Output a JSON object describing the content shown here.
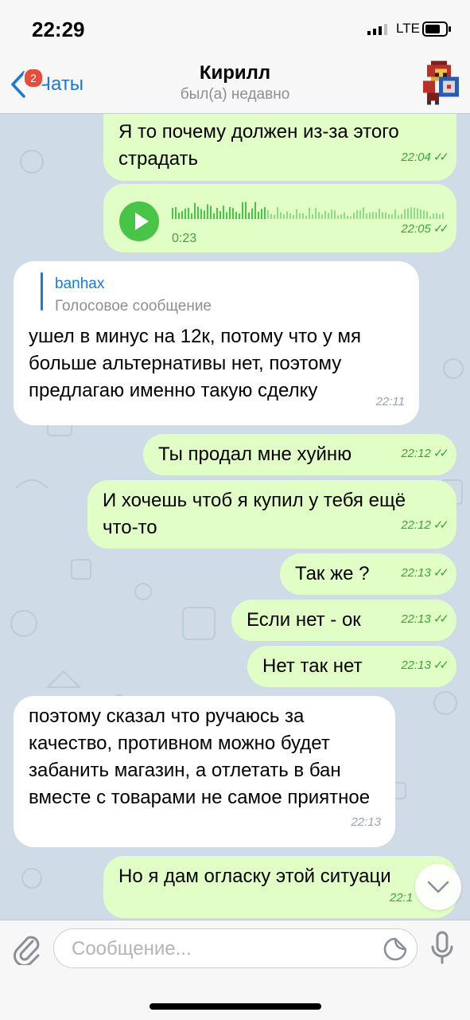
{
  "status_bar": {
    "time": "22:29",
    "network": "LTE"
  },
  "nav": {
    "back_label": "Чаты",
    "unread_badge": "2",
    "contact_name": "Кирилл",
    "contact_status": "был(а) недавно"
  },
  "messages": [
    {
      "direction": "out",
      "text": "Я то почему должен из-за этого страдать",
      "time": "22:04",
      "read": true
    },
    {
      "direction": "out",
      "type": "voice",
      "duration": "0:23",
      "time": "22:05",
      "read": true
    },
    {
      "direction": "in",
      "reply_to": {
        "name": "banhax",
        "text": "Голосовое сообщение"
      },
      "text": "ушел в минус на 12к, потому что у мя больше альтернативы нет, поэтому предлагаю именно такую сделку",
      "time": "22:11"
    },
    {
      "direction": "out",
      "text": "Ты продал мне хуйню",
      "time": "22:12",
      "read": true
    },
    {
      "direction": "out",
      "text": "И хочешь чтоб я купил у тебя ещё что-то",
      "time": "22:12",
      "read": true
    },
    {
      "direction": "out",
      "text": "Так же ?",
      "time": "22:13",
      "read": true
    },
    {
      "direction": "out",
      "text": "Если нет - ок",
      "time": "22:13",
      "read": true
    },
    {
      "direction": "out",
      "text": "Нет так нет",
      "time": "22:13",
      "read": true
    },
    {
      "direction": "in",
      "text": "поэтому сказал что ручаюсь за качество, противном можно будет забанить магазин, а отлетать в бан вместе с товарами не самое приятное",
      "time": "22:13"
    },
    {
      "direction": "out",
      "text": "Но я дам огласку этой ситуаци",
      "time": "22:1",
      "read": true
    }
  ],
  "input": {
    "placeholder": "Сообщение..."
  },
  "icons": {
    "back": "chevron-left-icon",
    "avatar": "pixel-avatar",
    "play": "play-icon",
    "read": "double-check-icon",
    "scroll_down": "chevron-down-icon",
    "attach": "paperclip-icon",
    "sticker": "sticker-icon",
    "mic": "microphone-icon"
  },
  "colors": {
    "accent": "#1a7ad6",
    "outgoing_bubble": "#e1fec6",
    "incoming_bubble": "#ffffff",
    "timestamp_out": "#3ca43a",
    "voice_play": "#48c448",
    "badge": "#e74c3c",
    "chat_background": "#cfdbe6"
  }
}
